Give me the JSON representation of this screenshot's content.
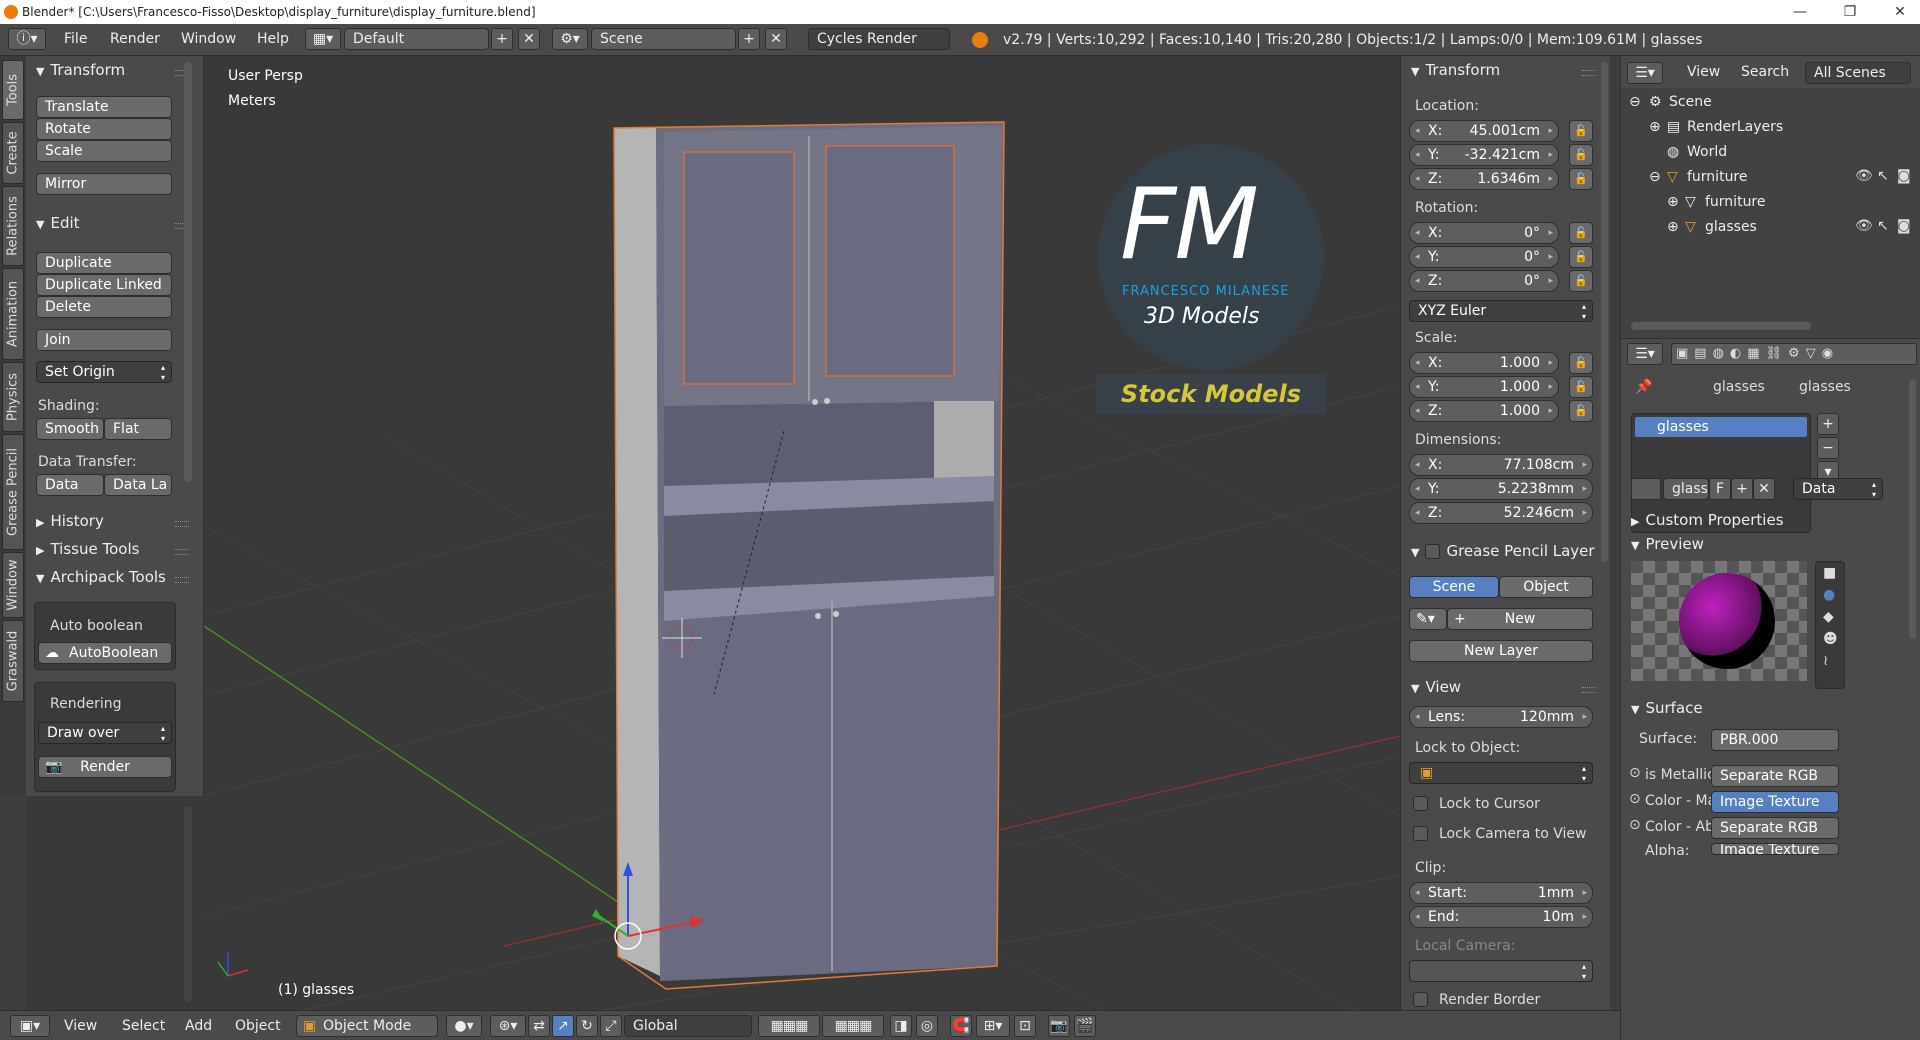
{
  "window": {
    "title": "Blender* [C:\\Users\\Francesco-Fisso\\Desktop\\display_furniture\\display_furniture.blend]",
    "minimize": "—",
    "maximize": "❐",
    "close": "✕"
  },
  "infobar": {
    "menus": [
      "File",
      "Render",
      "Window",
      "Help"
    ],
    "layout": "Default",
    "scene": "Scene",
    "engine": "Cycles Render",
    "stats": "v2.79 | Verts:10,292 | Faces:10,140 | Tris:20,280 | Objects:1/2 | Lamps:0/0 | Mem:109.61M | glasses"
  },
  "tabs": [
    "Tools",
    "Create",
    "Relations",
    "Animation",
    "Physics",
    "Grease Pencil",
    "Window",
    "Graswald"
  ],
  "toolshelf": {
    "transform": {
      "header": "Transform",
      "buttons": [
        "Translate",
        "Rotate",
        "Scale",
        "Mirror"
      ]
    },
    "edit": {
      "header": "Edit",
      "buttons": [
        "Duplicate",
        "Duplicate Linked",
        "Delete",
        "Join"
      ],
      "set_origin": "Set Origin",
      "shading_label": "Shading:",
      "smooth": "Smooth",
      "flat": "Flat",
      "data_transfer_label": "Data Transfer:",
      "data": "Data",
      "data_la": "Data La"
    },
    "history": "History",
    "tissue": "Tissue Tools",
    "archipack": "Archipack Tools",
    "auto_boolean": "Auto boolean",
    "autoboolean_btn": "AutoBoolean",
    "rendering": "Rendering",
    "draw_over": "Draw over",
    "render": "Render"
  },
  "viewport": {
    "view_name": "User Persp",
    "units": "Meters",
    "selected": "(1) glasses",
    "logo_letters": "FM",
    "logo_name": "FRANCESCO MILANESE",
    "logo_sub": "3D Models",
    "stock": "Stock Models"
  },
  "npanel": {
    "transform": "Transform",
    "location_label": "Location:",
    "location": [
      {
        "k": "X:",
        "v": "45.001cm"
      },
      {
        "k": "Y:",
        "v": "-32.421cm"
      },
      {
        "k": "Z:",
        "v": "1.6346m"
      }
    ],
    "rotation_label": "Rotation:",
    "rotation": [
      {
        "k": "X:",
        "v": "0°"
      },
      {
        "k": "Y:",
        "v": "0°"
      },
      {
        "k": "Z:",
        "v": "0°"
      }
    ],
    "rotation_mode": "XYZ Euler",
    "scale_label": "Scale:",
    "scale": [
      {
        "k": "X:",
        "v": "1.000"
      },
      {
        "k": "Y:",
        "v": "1.000"
      },
      {
        "k": "Z:",
        "v": "1.000"
      }
    ],
    "dimensions_label": "Dimensions:",
    "dimensions": [
      {
        "k": "X:",
        "v": "77.108cm"
      },
      {
        "k": "Y:",
        "v": "5.2238mm"
      },
      {
        "k": "Z:",
        "v": "52.246cm"
      }
    ],
    "grease": "Grease Pencil Layer",
    "scene_btn": "Scene",
    "object_btn": "Object",
    "new_btn": "New",
    "new_layer": "New Layer",
    "view": "View",
    "lens_k": "Lens:",
    "lens_v": "120mm",
    "lock_obj": "Lock to Object:",
    "lock_cursor": "Lock to Cursor",
    "lock_camera": "Lock Camera to View",
    "clip": "Clip:",
    "start_k": "Start:",
    "start_v": "1mm",
    "end_k": "End:",
    "end_v": "10m",
    "local_camera": "Local Camera:",
    "render_border": "Render Border"
  },
  "outliner": {
    "view": "View",
    "search": "Search",
    "all_scenes": "All Scenes",
    "items": [
      "Scene",
      "RenderLayers",
      "World",
      "furniture",
      "furniture",
      "glasses"
    ]
  },
  "properties": {
    "crumbs": [
      "glasses",
      "glasses"
    ],
    "slot": "glasses",
    "mat_name": "glass",
    "f": "F",
    "data": "Data",
    "custom": "Custom Properties",
    "preview": "Preview",
    "surface_header": "Surface",
    "surface_k": "Surface:",
    "surface_v": "PBR.000",
    "inputs": [
      {
        "k": "is Metallic",
        "v": "Separate RGB"
      },
      {
        "k": "Color - Ma",
        "v": "Image Texture"
      },
      {
        "k": "Color - Ab",
        "v": "Separate RGB"
      },
      {
        "k": "Alpha:",
        "v": "Image Texture"
      }
    ]
  },
  "bottombar": {
    "view": "View",
    "select": "Select",
    "add": "Add",
    "object": "Object",
    "mode": "Object Mode",
    "orientation": "Global"
  },
  "colors": {
    "accent": "#5680c2",
    "selection": "#e07a3a",
    "logo_blue": "#1e9fe0",
    "stock_yellow": "#d4c83a"
  }
}
